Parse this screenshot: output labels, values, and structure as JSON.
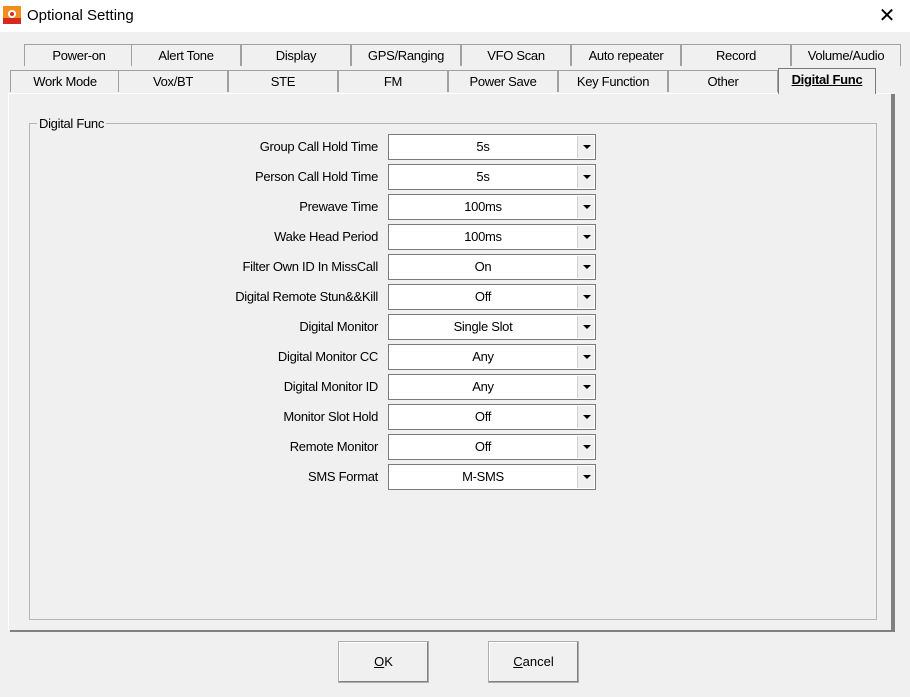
{
  "window": {
    "title": "Optional Setting",
    "close_symbol": "✕"
  },
  "tabs_row1": [
    "Power-on",
    "Alert Tone",
    "Display",
    "GPS/Ranging",
    "VFO Scan",
    "Auto repeater",
    "Record",
    "Volume/Audio"
  ],
  "tabs_row2": [
    "Work Mode",
    "Vox/BT",
    "STE",
    "FM",
    "Power Save",
    "Key Function",
    "Other",
    "Digital Func"
  ],
  "active_tab": "Digital Func",
  "group": {
    "title": "Digital Func"
  },
  "settings": [
    {
      "label": "Group Call Hold Time",
      "value": "5s"
    },
    {
      "label": "Person Call Hold Time",
      "value": "5s"
    },
    {
      "label": "Prewave Time",
      "value": "100ms"
    },
    {
      "label": "Wake Head Period",
      "value": "100ms"
    },
    {
      "label": "Filter Own ID In MissCall",
      "value": "On"
    },
    {
      "label": "Digital Remote Stun&&Kill",
      "value": "Off"
    },
    {
      "label": "Digital Monitor",
      "value": "Single Slot"
    },
    {
      "label": "Digital Monitor CC",
      "value": "Any"
    },
    {
      "label": "Digital Monitor ID",
      "value": "Any"
    },
    {
      "label": "Monitor Slot Hold",
      "value": "Off"
    },
    {
      "label": "Remote Monitor",
      "value": "Off"
    },
    {
      "label": "SMS Format",
      "value": "M-SMS"
    }
  ],
  "buttons": {
    "ok": {
      "mnemonic": "O",
      "rest": "K"
    },
    "cancel": {
      "mnemonic": "C",
      "rest": "ancel"
    }
  },
  "icons": {
    "app": "app-logo-icon",
    "close": "close-icon",
    "dropdown": "chevron-down-icon"
  },
  "colors": {
    "app_icon_orange": "#f28c1c",
    "app_icon_red": "#d62a1e"
  }
}
